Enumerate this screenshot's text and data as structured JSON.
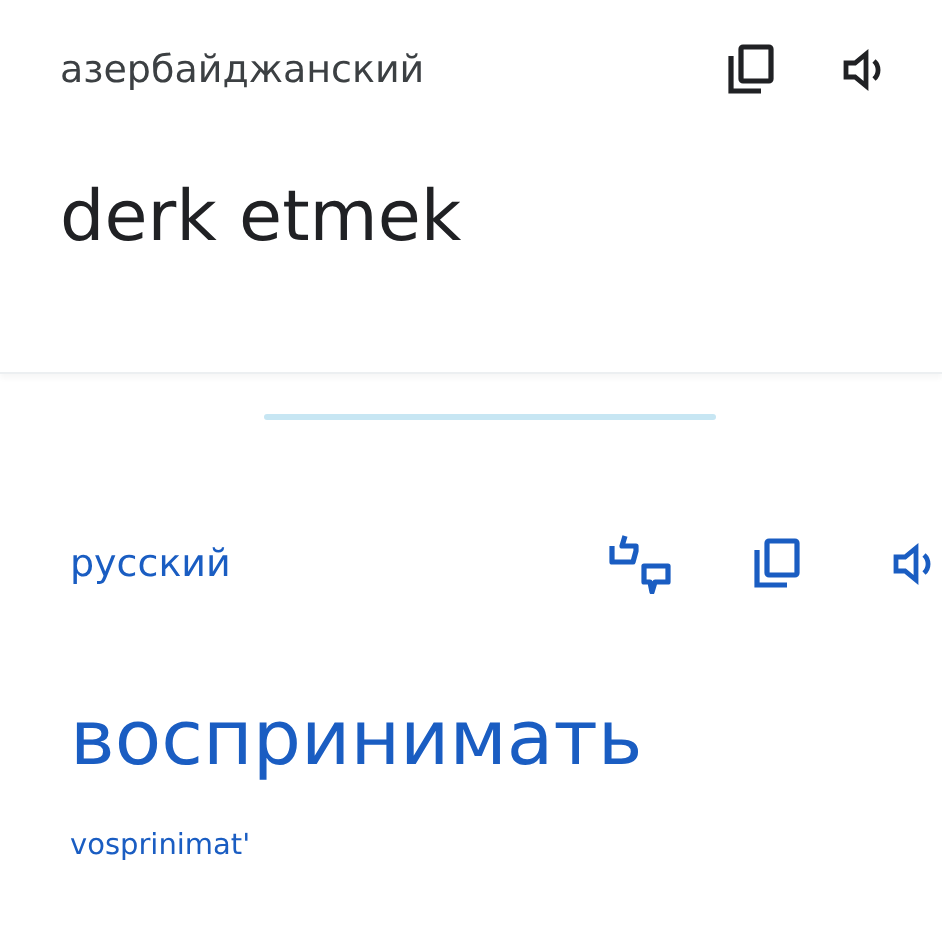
{
  "source": {
    "language": "азербайджанский",
    "text": "derk etmek"
  },
  "target": {
    "language": "русский",
    "text": "воспринимать",
    "transliteration": "vosprinimat'"
  }
}
